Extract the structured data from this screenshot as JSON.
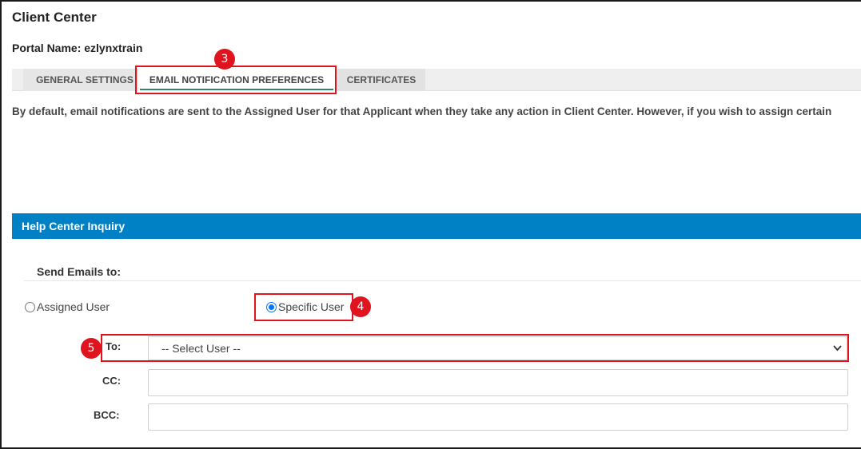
{
  "header": {
    "title": "Client Center",
    "portal_name": "Portal Name: ezlynxtrain"
  },
  "tabs": [
    {
      "label": "GENERAL SETTINGS",
      "active": false
    },
    {
      "label": "EMAIL NOTIFICATION PREFERENCES",
      "active": true
    },
    {
      "label": "CERTIFICATES",
      "active": false
    }
  ],
  "description": "By default, email notifications are sent to the Assigned User for that Applicant when they take any action in Client Center. However, if you wish to assign certain",
  "section": {
    "title": "Help Center Inquiry",
    "send_emails_label": "Send Emails to:"
  },
  "recipient_options": [
    {
      "label": "Assigned User",
      "selected": false
    },
    {
      "label": "Specific User",
      "selected": true
    }
  ],
  "fields": {
    "to_label": "To:",
    "to_value": "-- Select User --",
    "cc_label": "CC:",
    "bcc_label": "BCC:"
  },
  "annotations": {
    "step_tab": "3",
    "step_radio": "4",
    "step_to": "5",
    "color": "#e0141e"
  },
  "colors": {
    "section_bar": "#0081c6",
    "tab_underline": "#2c8c6a",
    "radio_checked": "#0075ff"
  },
  "icons": {
    "select_chevron": "chevron-down-icon"
  }
}
